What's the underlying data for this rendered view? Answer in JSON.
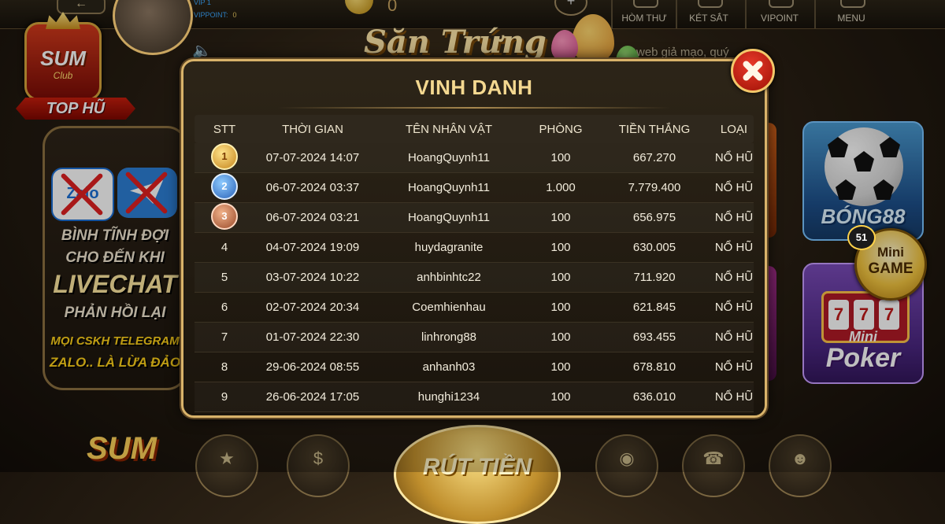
{
  "topbar": {
    "vip_label": "VIP",
    "vip_level": "1",
    "vippoint_label": "VIPPOINT:",
    "vippoint_value": "0",
    "coin_value": "0",
    "menu": [
      {
        "label": "HÒM THƯ",
        "icon": "mailbox-icon"
      },
      {
        "label": "KÉT SẮT",
        "icon": "safe-icon"
      },
      {
        "label": "VIPOINT",
        "icon": "vip-point-icon"
      },
      {
        "label": "MENU",
        "icon": "menu-icon"
      }
    ]
  },
  "brand": {
    "logo_text": "SUM",
    "logo_sub": "Club",
    "tag": "TOP HŨ"
  },
  "warning_panel": {
    "zalo_text": "Zalo",
    "lines": [
      "BÌNH TĨNH ĐỢI",
      "CHO ĐẾN KHI",
      "LIVECHAT",
      "PHẢN HỒI LẠI",
      "MỌI CSKH TELEGRAM",
      "ZALO.. LÀ LỪA ĐẢO"
    ]
  },
  "banner": {
    "title": "Săn Trứng",
    "ticker": "web giả mạo, quý"
  },
  "right_games": {
    "bong88": "BÓNG88",
    "minigame_line1": "Mini",
    "minigame_line2": "GAME",
    "minigame_badge": "51",
    "poker_mini": "Mini",
    "poker": "Poker",
    "slot_reels": [
      "7",
      "7",
      "7"
    ]
  },
  "bottom": {
    "withdraw_label": "RÚT TIỀN",
    "logo_text": "SUM"
  },
  "popup": {
    "title": "VINH DANH",
    "columns": [
      "STT",
      "THỜI GIAN",
      "TÊN NHÂN VẬT",
      "PHÒNG",
      "TIỀN THẮNG",
      "LOẠI"
    ],
    "rows": [
      {
        "rank": "1",
        "time": "07-07-2024 14:07",
        "name": "HoangQuynh11",
        "room": "100",
        "win": "667.270",
        "type": "NỔ HŨ"
      },
      {
        "rank": "2",
        "time": "06-07-2024 03:37",
        "name": "HoangQuynh11",
        "room": "1.000",
        "win": "7.779.400",
        "type": "NỔ HŨ"
      },
      {
        "rank": "3",
        "time": "06-07-2024 03:21",
        "name": "HoangQuynh11",
        "room": "100",
        "win": "656.975",
        "type": "NỔ HŨ"
      },
      {
        "rank": "4",
        "time": "04-07-2024 19:09",
        "name": "huydagranite",
        "room": "100",
        "win": "630.005",
        "type": "NỔ HŨ"
      },
      {
        "rank": "5",
        "time": "03-07-2024 10:22",
        "name": "anhbinhtc22",
        "room": "100",
        "win": "711.920",
        "type": "NỔ HŨ"
      },
      {
        "rank": "6",
        "time": "02-07-2024 20:34",
        "name": "Coemhienhau",
        "room": "100",
        "win": "621.845",
        "type": "NỔ HŨ"
      },
      {
        "rank": "7",
        "time": "01-07-2024 22:30",
        "name": "linhrong88",
        "room": "100",
        "win": "693.455",
        "type": "NỔ HŨ"
      },
      {
        "rank": "8",
        "time": "29-06-2024 08:55",
        "name": "anhanh03",
        "room": "100",
        "win": "678.810",
        "type": "NỔ HŨ"
      },
      {
        "rank": "9",
        "time": "26-06-2024 17:05",
        "name": "hunghi1234",
        "room": "100",
        "win": "636.010",
        "type": "NỔ HŨ"
      }
    ]
  }
}
